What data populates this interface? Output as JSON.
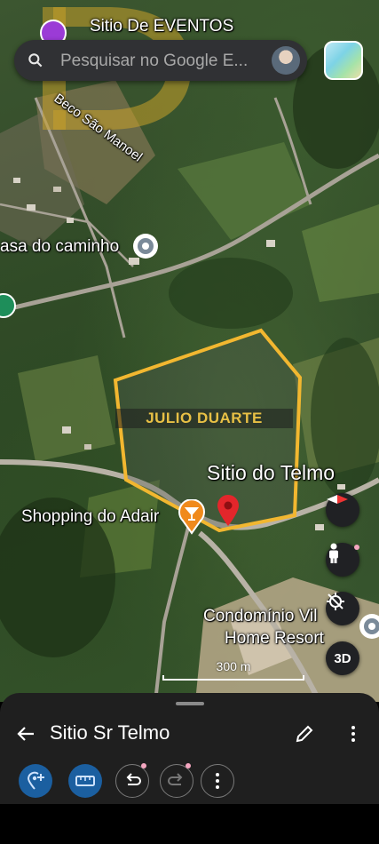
{
  "map": {
    "labels": {
      "venue": "Sitio De EVENTOS",
      "street": "Beco São Manoel",
      "casa": "asa do caminho",
      "sitio": "Sitio do Telmo",
      "shopping": "Shopping do Adair",
      "condominio_line1": "Condomínio Vil",
      "condominio_line2": "Home Resort"
    },
    "watermark": {
      "name": "JULIO DUARTE"
    },
    "scale": "300 m",
    "button_3d": "3D",
    "colors": {
      "boundary": "#f2b730",
      "pin_red": "#e3262b",
      "pin_orange": "#f08a1c"
    }
  },
  "search": {
    "placeholder": "Pesquisar no Google E..."
  },
  "sheet": {
    "title": "Sitio Sr Telmo"
  },
  "icons": [
    "search-icon",
    "layers-icon",
    "compass-icon",
    "pegman-icon",
    "location-off-icon",
    "back-arrow-icon",
    "edit-icon",
    "more-vert-icon",
    "add-point-icon",
    "ruler-icon",
    "undo-icon",
    "redo-icon"
  ]
}
